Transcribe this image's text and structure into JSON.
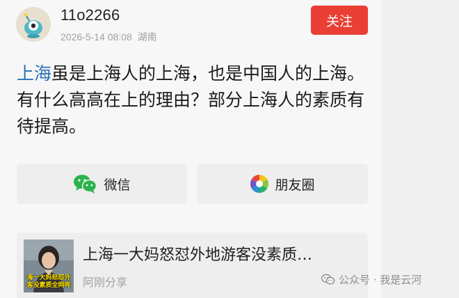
{
  "header": {
    "username": "11o2266",
    "timestamp": "2026-5-14 08:08",
    "location": "湖南",
    "follow_label": "关注",
    "follow_color": "#ea3f35"
  },
  "post": {
    "topic_link": "上海",
    "text_rest": "虽是上海人的上海，也是中国人的上海。有什么高高在上的理由？部分上海人的素质有待提高。",
    "topic_color": "#2b6fb8"
  },
  "share": {
    "wechat_label": "微信",
    "wechat_icon": "wechat-icon",
    "moments_label": "朋友圈",
    "moments_icon": "moments-icon"
  },
  "video": {
    "title": "上海一大妈怒怼外地游客没素质…",
    "subtitle": "阿刚分享",
    "thumb_caption_1": "海一大妈怒怼外",
    "thumb_caption_2": "客没素质全网哗"
  },
  "watermark": {
    "text": "公众号 · 我是云河"
  }
}
